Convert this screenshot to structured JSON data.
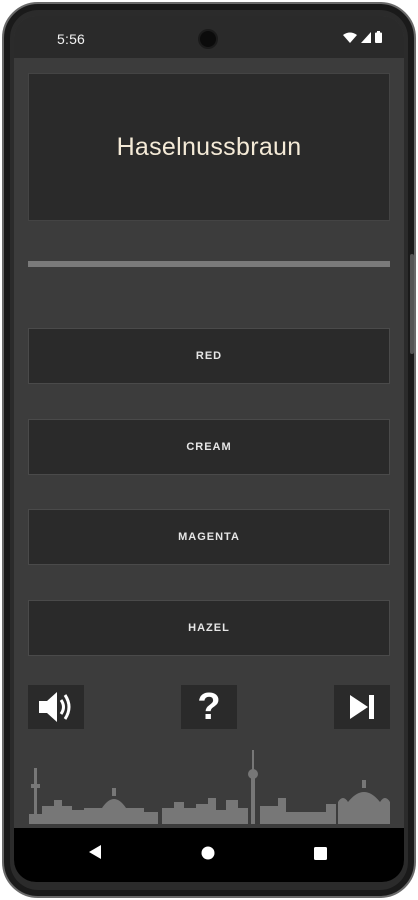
{
  "status_bar": {
    "time": "5:56",
    "icons": [
      "wifi-icon",
      "cellular-signal-icon",
      "battery-icon"
    ]
  },
  "quiz": {
    "word": "Haselnussbraun",
    "progress": 1.0,
    "options": [
      {
        "label": "RED"
      },
      {
        "label": "CREAM"
      },
      {
        "label": "MAGENTA"
      },
      {
        "label": "HAZEL"
      }
    ]
  },
  "controls": {
    "sound_icon": "speaker-icon",
    "help_icon": "help-icon",
    "help_label": "?",
    "next_icon": "skip-next-icon"
  },
  "nav_bar": {
    "icons": [
      "back-icon",
      "home-icon",
      "recents-icon"
    ]
  },
  "colors": {
    "screen_bg": "#3c3c3c",
    "card_bg": "#2a2a2a",
    "word_text": "#f4ead7",
    "skyline": "#777777"
  }
}
